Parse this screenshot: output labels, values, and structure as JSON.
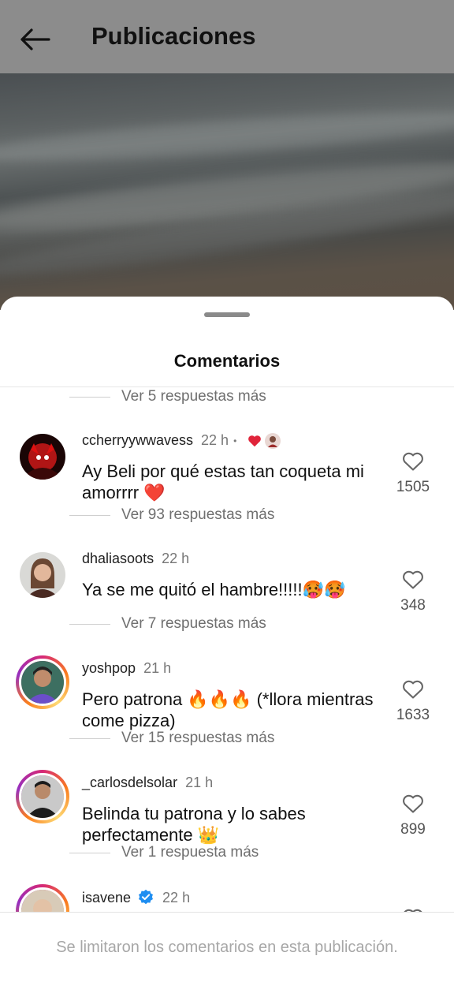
{
  "header": {
    "title": "Publicaciones"
  },
  "sheet": {
    "title": "Comentarios"
  },
  "top_more": {
    "label": "Ver 5 respuestas más"
  },
  "comments": [
    {
      "username": "ccherryywwavess",
      "time": "22 h",
      "text": "Ay Beli por qué estas tan coqueta mi amorrrr ❤️",
      "likes": "1505",
      "replies": "Ver 93 respuestas más"
    },
    {
      "username": "dhaliasoots",
      "time": "22 h",
      "text": "Ya se me quitó el hambre!!!!!🥵🥵",
      "likes": "348",
      "replies": "Ver 7 respuestas más"
    },
    {
      "username": "yoshpop",
      "time": "21 h",
      "text": "Pero patrona 🔥🔥🔥 (*llora mientras come pizza)",
      "likes": "1633",
      "replies": "Ver 15 respuestas más"
    },
    {
      "username": "_carlosdelsolar",
      "time": "21 h",
      "text": "Belinda tu patrona y lo sabes perfectamente 👑",
      "likes": "899",
      "replies": "Ver 1 respuesta más"
    },
    {
      "username": "isavene",
      "time": "22 h"
    }
  ],
  "footer": {
    "text": "Se limitaron los comentarios en esta publicación."
  },
  "colors": {
    "like_red": "#e0243a",
    "verified_blue": "#1f8ef1",
    "topbar": "#8c8c8c"
  }
}
